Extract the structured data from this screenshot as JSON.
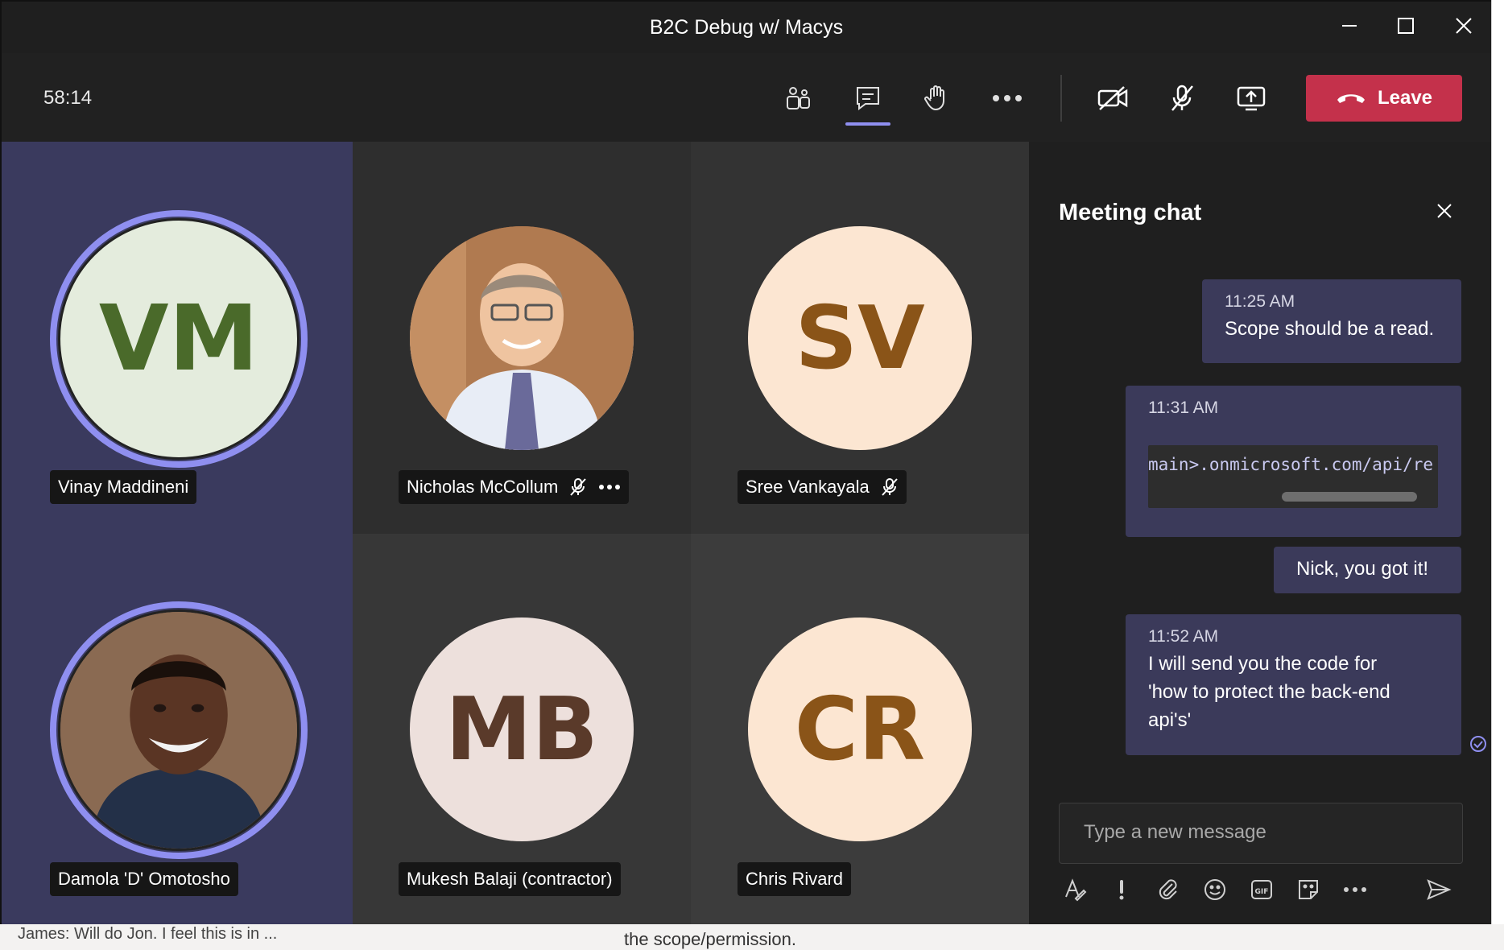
{
  "window": {
    "title": "B2C Debug w/ Macys"
  },
  "toolbar": {
    "timer": "58:14",
    "leave_label": "Leave"
  },
  "participants": [
    {
      "name": "Vinay Maddineni",
      "initials": "VM",
      "avatar_bg": "#e4ecdd",
      "initials_color": "#4a6a2a",
      "speaking": true
    },
    {
      "name": "Nicholas McCollum",
      "initials": "",
      "avatar_bg": "#8a7a6a",
      "muted": true,
      "photo": true
    },
    {
      "name": "Sree Vankayala",
      "initials": "SV",
      "avatar_bg": "#fce6d2",
      "initials_color": "#8a5418",
      "muted": true
    },
    {
      "name": "Damola 'D' Omotosho",
      "initials": "",
      "avatar_bg": "#6b4a36",
      "speaking": true,
      "photo": true
    },
    {
      "name": "Mukesh Balaji (contractor)",
      "initials": "MB",
      "avatar_bg": "#ede0dc",
      "initials_color": "#5a3a2a"
    },
    {
      "name": "Chris Rivard",
      "initials": "CR",
      "avatar_bg": "#fce6d2",
      "initials_color": "#8a5418"
    }
  ],
  "chat": {
    "title": "Meeting chat",
    "messages": [
      {
        "time": "11:25 AM",
        "text": "Scope should be a read."
      },
      {
        "time": "11:31 AM",
        "code": "main>.onmicrosoft.com/api/re"
      },
      {
        "text": "Nick, you got it!"
      },
      {
        "time": "11:52 AM",
        "lines": [
          "I will send you the code for",
          "'how to protect the back-end",
          "api's'"
        ]
      }
    ],
    "compose_placeholder": "Type a new message"
  },
  "background": {
    "bottom_left": "James: Will do Jon. I feel this is in ...",
    "bottom_mid": "the scope/permission."
  },
  "colors": {
    "accent_ring": "#8f8ff0",
    "leave_red": "#c4314b",
    "bubble": "#3b3a5a"
  }
}
